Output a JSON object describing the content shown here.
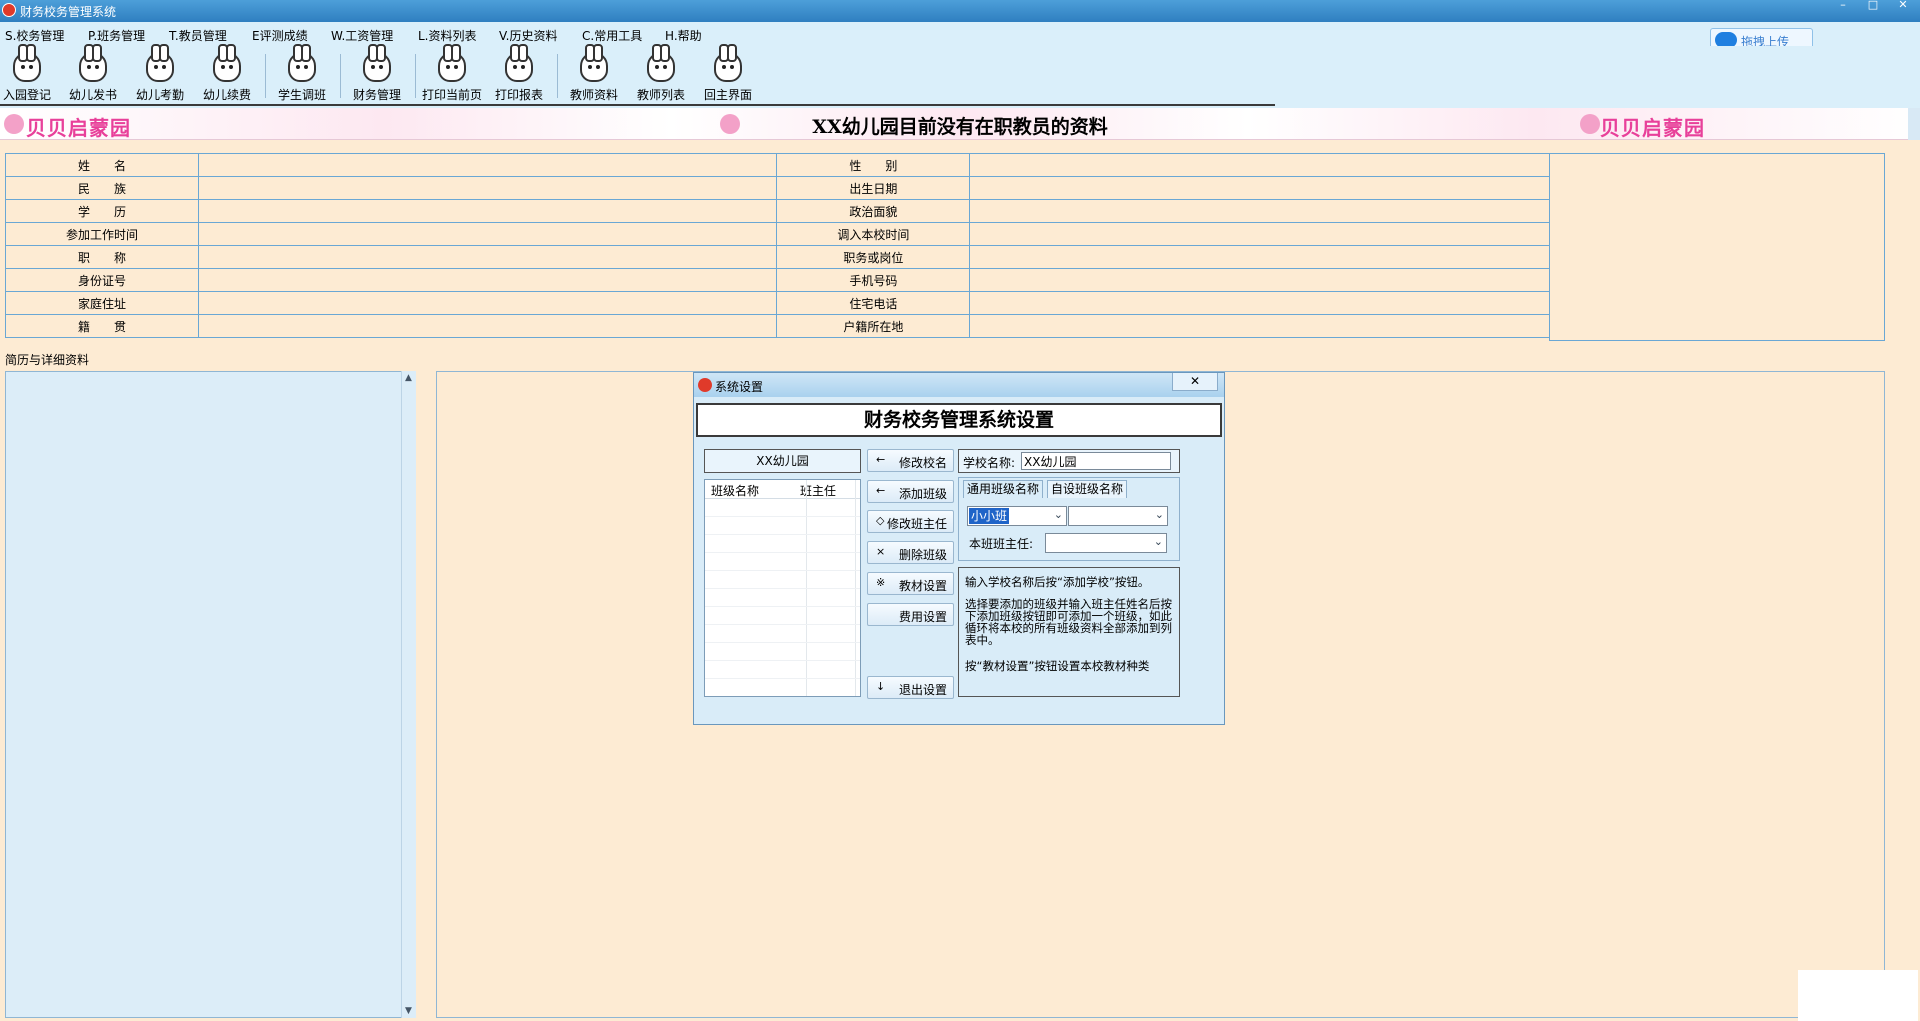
{
  "window": {
    "title": "财务校务管理系统",
    "controls": [
      "–",
      "□",
      "✕"
    ]
  },
  "menu": [
    "S.校务管理",
    "P.班务管理",
    "T.教员管理",
    "E评测成绩",
    "W.工资管理",
    "L.资料列表",
    "V.历史资料",
    "C.常用工具",
    "H.帮助"
  ],
  "upload_button": {
    "label": "拖拽上传",
    "icon": "cloud-icon"
  },
  "toolbar": [
    {
      "label": "入园登记",
      "icon": "rabbit-icon"
    },
    {
      "label": "幼儿发书",
      "icon": "rabbit-icon"
    },
    {
      "label": "幼儿考勤",
      "icon": "rabbit-icon"
    },
    {
      "label": "幼儿续费",
      "icon": "rabbit-icon"
    },
    {
      "label": "学生调班",
      "icon": "rabbit-icon"
    },
    {
      "label": "财务管理",
      "icon": "rabbit-icon"
    },
    {
      "label": "打印当前页",
      "icon": "rabbit-icon"
    },
    {
      "label": "打印报表",
      "icon": "rabbit-icon"
    },
    {
      "label": "教师资料",
      "icon": "rabbit-icon"
    },
    {
      "label": "教师列表",
      "icon": "rabbit-icon"
    },
    {
      "label": "回主界面",
      "icon": "rabbit-icon"
    }
  ],
  "banner": {
    "logo_left": "贝贝启蒙园",
    "logo_right": "贝贝启蒙园",
    "message": "XX幼儿园目前没有在职教员的资料"
  },
  "info_rows": [
    {
      "left_label": "姓　　名",
      "right_label": "性　　别"
    },
    {
      "left_label": "民　　族",
      "right_label": "出生日期"
    },
    {
      "left_label": "学　　历",
      "right_label": "政治面貌"
    },
    {
      "left_label": "参加工作时间",
      "right_label": "调入本校时间"
    },
    {
      "left_label": "职　　称",
      "right_label": "职务或岗位"
    },
    {
      "left_label": "身份证号",
      "right_label": "手机号码"
    },
    {
      "left_label": "家庭住址",
      "right_label": "住宅电话"
    },
    {
      "left_label": "籍　　贯",
      "right_label": "户籍所在地"
    }
  ],
  "resume_label": "简历与详细资料",
  "dialog": {
    "title": "系统设置",
    "close": "✕",
    "heading": "财务校务管理系统设置",
    "school_display": "XX幼儿园",
    "class_list_headers": [
      "班级名称",
      "班主任"
    ],
    "buttons": [
      {
        "glyph": "←",
        "label": "修改校名"
      },
      {
        "glyph": "←",
        "label": "添加班级"
      },
      {
        "glyph": "◇",
        "label": "修改班主任"
      },
      {
        "glyph": "×",
        "label": "删除班级"
      },
      {
        "glyph": "※",
        "label": "教材设置"
      },
      {
        "glyph": "",
        "label": "费用设置"
      },
      {
        "glyph": "↓",
        "label": "退出设置"
      }
    ],
    "school_name_label": "学校名称:",
    "school_name_value": "XX幼儿园",
    "tabs": [
      "通用班级名称",
      "自设班级名称"
    ],
    "class_select_value": "小小班",
    "teacher_label": "本班班主任:",
    "help": [
      "输入学校名称后按“添加学校”按钮。",
      "选择要添加的班级并输入班主任姓名后按下添加班级按钮即可添加一个班级，如此循环将本校的所有班级资料全部添加到列表中。",
      "按“教材设置”按钮设置本校教材种类"
    ]
  }
}
